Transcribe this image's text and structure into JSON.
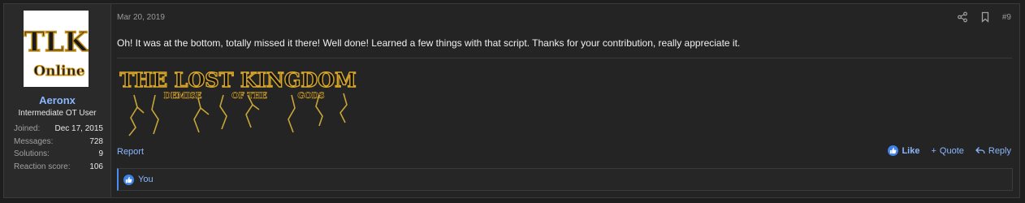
{
  "post": {
    "date": "Mar 20, 2019",
    "number": "#9",
    "message": "Oh! It was at the bottom, totally missed it there! Well done! Learned a few things with that script. Thanks for your contribution, really appreciate it."
  },
  "user": {
    "avatar_text_top": "TLK",
    "avatar_text_bottom": "Online",
    "name": "Aeronx",
    "title": "Intermediate OT User",
    "stats": [
      {
        "label": "Joined:",
        "value": "Dec 17, 2015"
      },
      {
        "label": "Messages:",
        "value": "728"
      },
      {
        "label": "Solutions:",
        "value": "9"
      },
      {
        "label": "Reaction score:",
        "value": "106"
      }
    ]
  },
  "signature": {
    "line1": "THE LOST KINGDOM",
    "line2_a": "DEMISE",
    "line2_b": "OF THE",
    "line2_c": "GODS"
  },
  "footer": {
    "report": "Report",
    "like": "Like",
    "quote": "Quote",
    "reply": "Reply"
  },
  "reactions": {
    "text": "You"
  },
  "colors": {
    "accent": "#8ab6ff",
    "like_blue": "#3f83ea",
    "background": "#242424"
  },
  "icons": [
    "share-icon",
    "bookmark-icon",
    "like-icon",
    "plus-icon",
    "reply-icon"
  ]
}
